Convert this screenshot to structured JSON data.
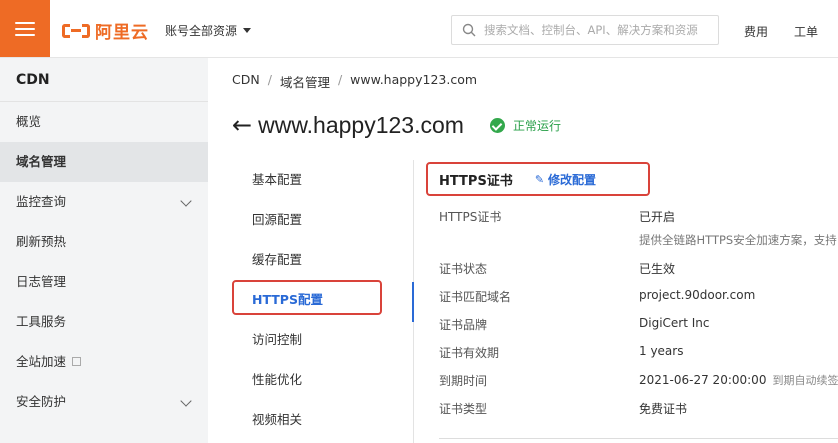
{
  "topbar": {
    "brand": "阿里云",
    "account_label": "账号全部资源",
    "search_placeholder": "搜索文档、控制台、API、解决方案和资源",
    "links": [
      "费用",
      "工单"
    ],
    "accent": "#ee6b25"
  },
  "sidebar": {
    "title": "CDN",
    "items": [
      {
        "label": "概览"
      },
      {
        "label": "域名管理",
        "active": true
      },
      {
        "label": "监控查询",
        "expandable": true
      },
      {
        "label": "刷新预热"
      },
      {
        "label": "日志管理"
      },
      {
        "label": "工具服务"
      },
      {
        "label": "全站加速",
        "external": true
      },
      {
        "label": "安全防护",
        "expandable": true
      }
    ]
  },
  "breadcrumb": [
    "CDN",
    "域名管理",
    "www.happy123.com"
  ],
  "page": {
    "title": "www.happy123.com",
    "status": "正常运行",
    "status_color": "#2aa04a"
  },
  "subnav": {
    "items": [
      "基本配置",
      "回源配置",
      "缓存配置",
      "HTTPS配置",
      "访问控制",
      "性能优化",
      "视频相关"
    ],
    "active_index": 3,
    "active_color": "#2a6ad6"
  },
  "panel": {
    "title": "HTTPS证书",
    "edit_label": "修改配置",
    "rows": [
      {
        "label": "HTTPS证书",
        "value": "已开启",
        "sub": "提供全链路HTTPS安全加速方案，支持"
      },
      {
        "label": "证书状态",
        "value": "已生效"
      },
      {
        "label": "证书匹配域名",
        "value": "project.90door.com"
      },
      {
        "label": "证书品牌",
        "value": "DigiCert Inc"
      },
      {
        "label": "证书有效期",
        "value": "1 years"
      },
      {
        "label": "到期时间",
        "value": "2021-06-27 20:00:00",
        "note": "到期自动续签"
      },
      {
        "label": "证书类型",
        "value": "免费证书"
      }
    ]
  },
  "highlight_color": "#d9433a"
}
